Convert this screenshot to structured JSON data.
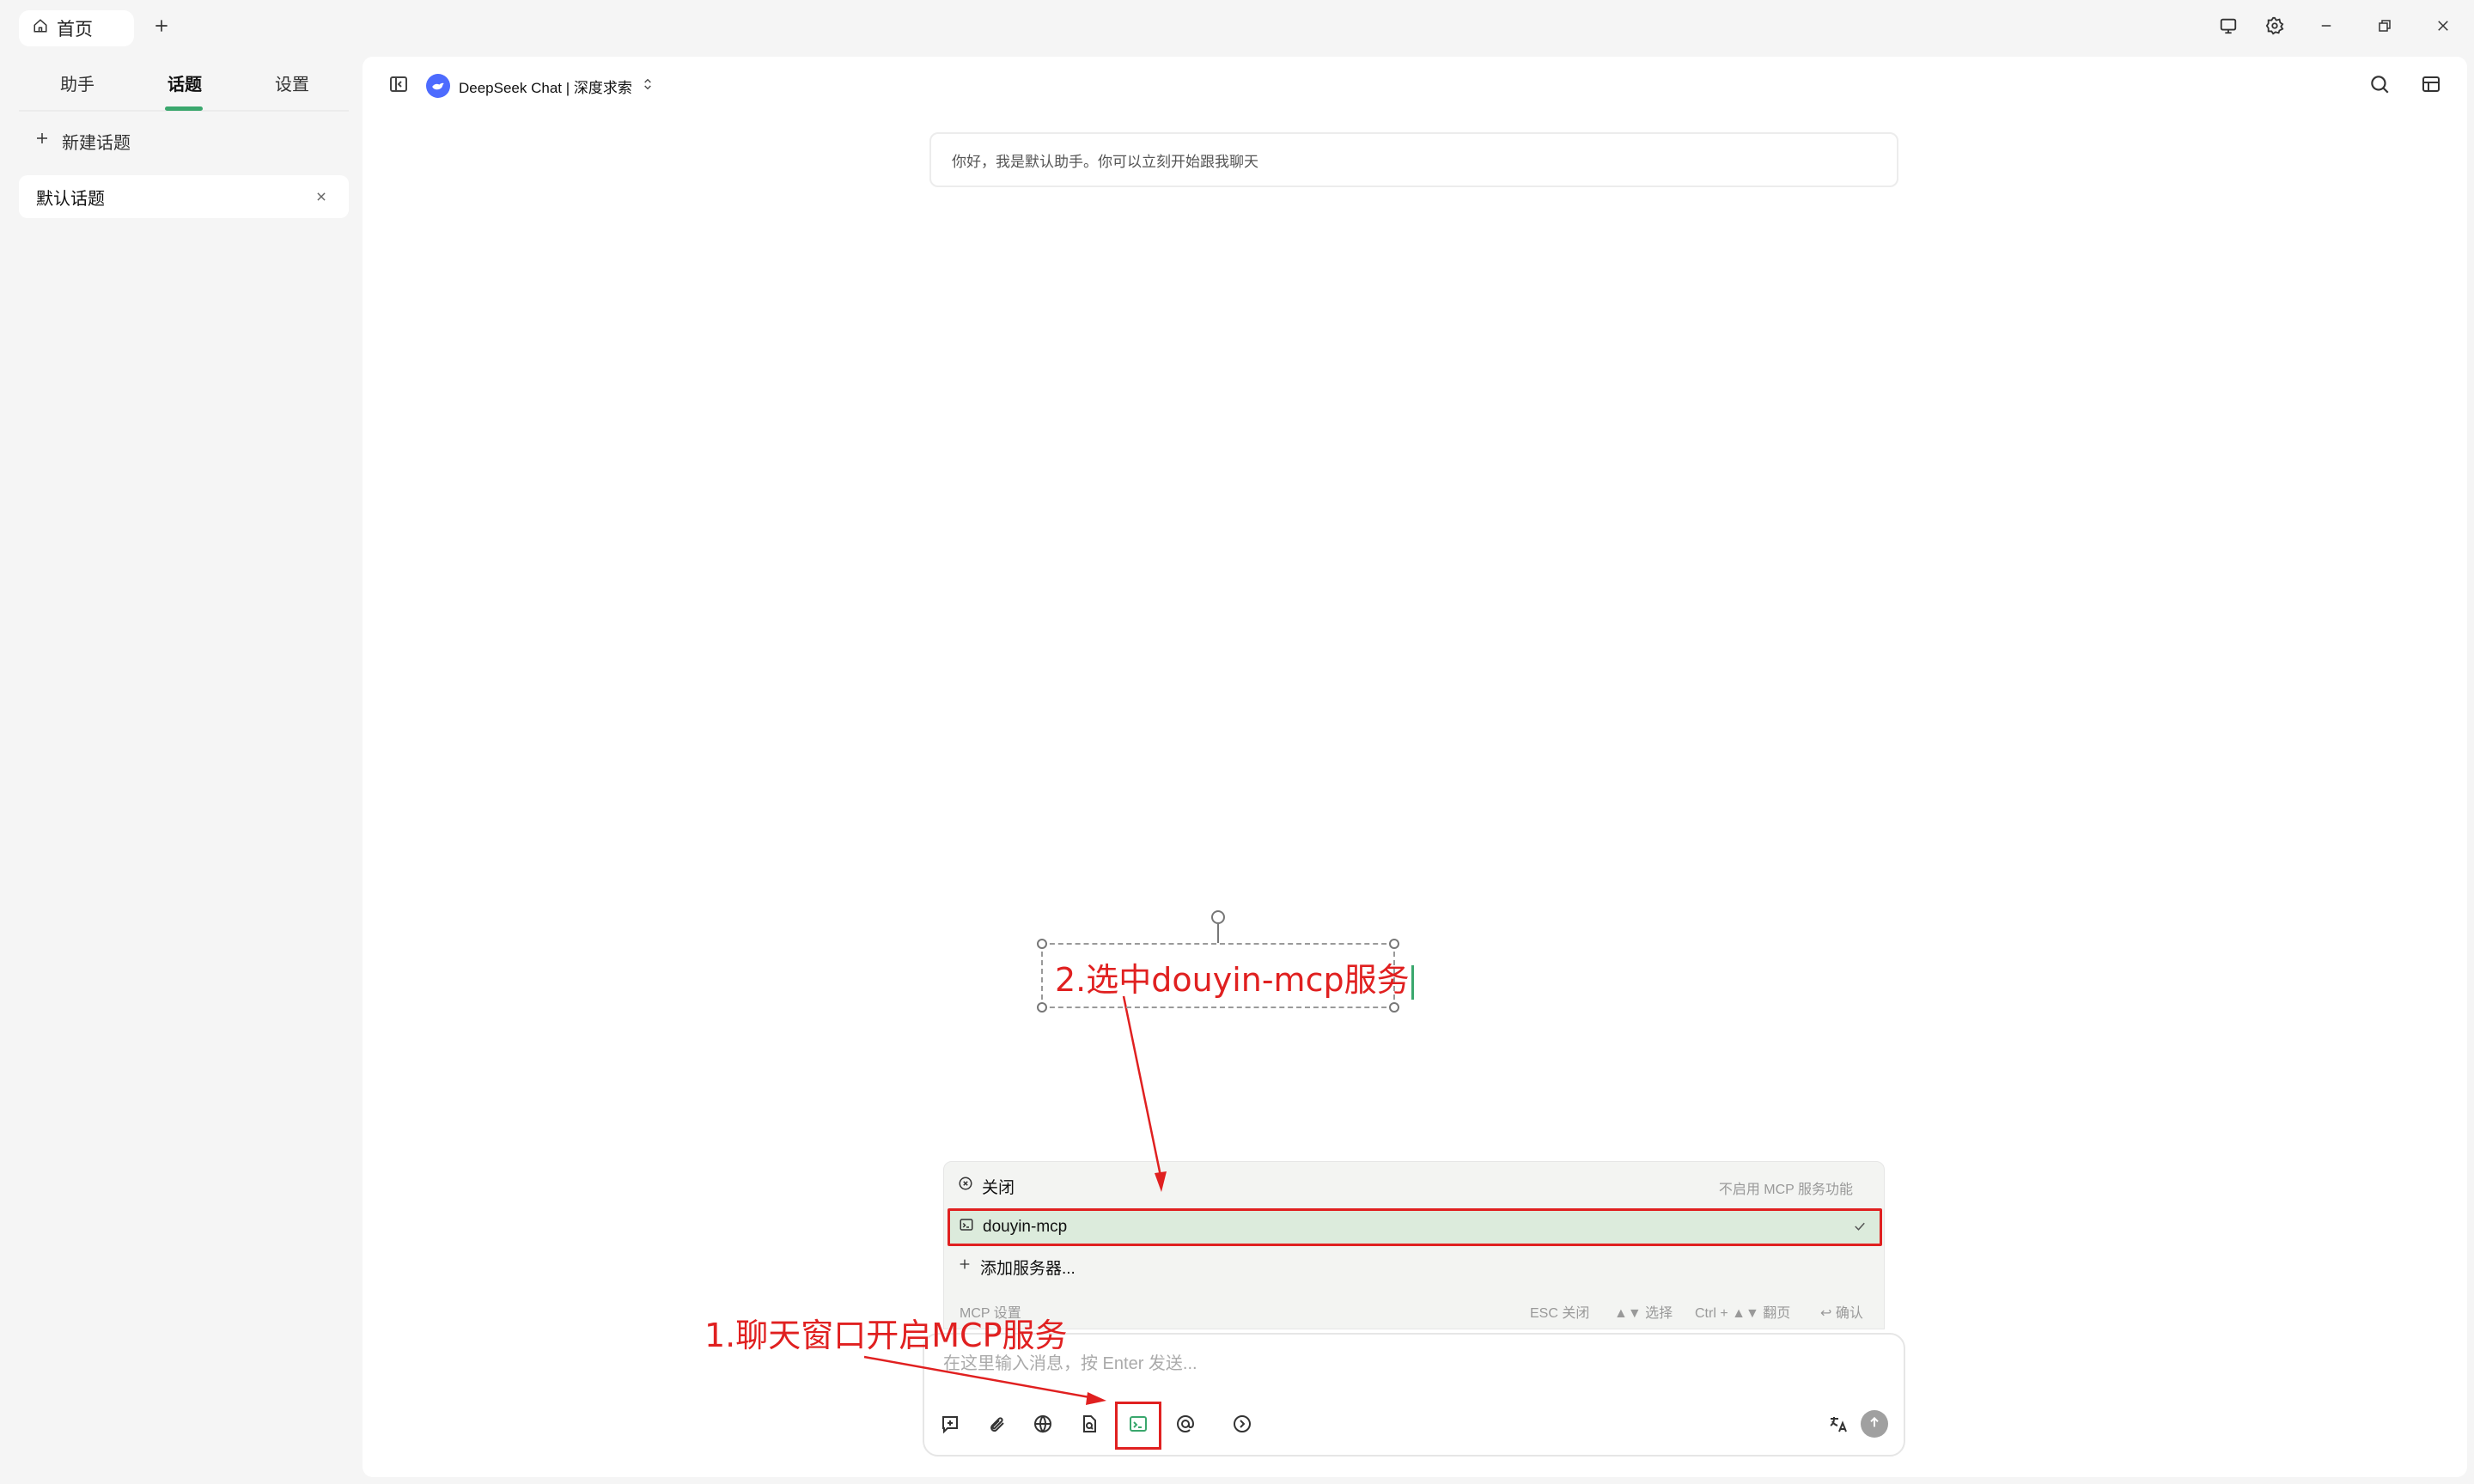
{
  "titlebar": {
    "home_tab_label": "首页",
    "icons": [
      "home-icon",
      "plus-icon",
      "monitor-icon",
      "gear-icon",
      "minimize-icon",
      "restore-icon",
      "close-icon"
    ]
  },
  "sidebar": {
    "tabs": [
      {
        "label": "助手"
      },
      {
        "label": "话题"
      },
      {
        "label": "设置"
      }
    ],
    "active_tab": "话题",
    "new_topic_label": "新建话题",
    "topics": [
      {
        "label": "默认话题"
      }
    ]
  },
  "header": {
    "model_name": "DeepSeek Chat | 深度求索",
    "icons": [
      "sidebar-toggle-icon",
      "search-icon",
      "layout-icon"
    ]
  },
  "chat": {
    "welcome_message": "你好，我是默认助手。你可以立刻开始跟我聊天"
  },
  "mcp_menu": {
    "items": [
      {
        "label": "关闭",
        "hint": "不启用 MCP 服务功能",
        "icon": "close-circle-icon"
      },
      {
        "label": "douyin-mcp",
        "selected": true,
        "icon": "terminal-icon"
      },
      {
        "label": "添加服务器...",
        "icon": "plus-icon"
      }
    ],
    "footer": {
      "settings_label": "MCP 设置",
      "shortcuts": [
        "ESC 关闭",
        "▲▼ 选择",
        "Ctrl + ▲▼ 翻页",
        "↩ 确认"
      ]
    }
  },
  "input": {
    "placeholder": "在这里输入消息，按 Enter 发送...",
    "tools": [
      "new-topic-icon",
      "paperclip-icon",
      "globe-icon",
      "file-search-icon",
      "terminal-icon",
      "at-icon",
      "chevron-right-circle-icon"
    ],
    "right_tools": [
      "translate-icon",
      "send-icon"
    ]
  },
  "annotations": {
    "step1": "1.聊天窗口开启MCP服务",
    "step2": "2.选中douyin-mcp服务",
    "color": "#e02020"
  },
  "colors": {
    "accent": "#3aa76d",
    "annotation_red": "#e02020",
    "deepseek_blue": "#4d6bfe",
    "selected_row_bg": "#dcebdc"
  }
}
